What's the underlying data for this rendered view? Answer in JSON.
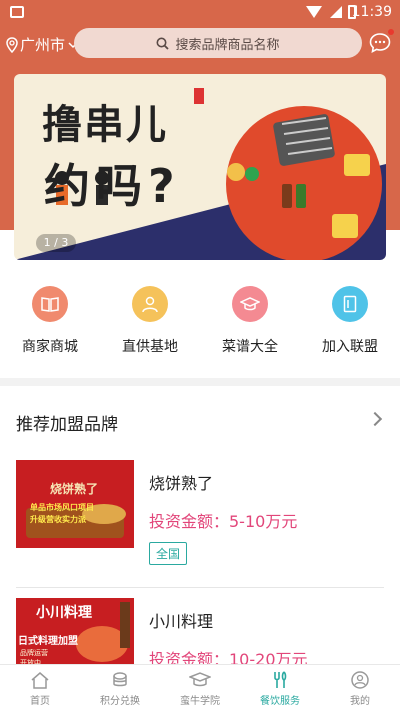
{
  "status": {
    "time": "11:39"
  },
  "header": {
    "city": "广州市",
    "search_placeholder": "搜索品牌商品名称"
  },
  "banner": {
    "title": "撸串儿",
    "subtitle": "约吗?",
    "pager": "1 / 3"
  },
  "grid": [
    {
      "label": "商家商城",
      "icon": "shop-book-icon",
      "color": "#f08a6e"
    },
    {
      "label": "直供基地",
      "icon": "person-icon",
      "color": "#f5c25a"
    },
    {
      "label": "菜谱大全",
      "icon": "graduation-cap-icon",
      "color": "#f48a92"
    },
    {
      "label": "加入联盟",
      "icon": "document-icon",
      "color": "#4fc3e8"
    }
  ],
  "section": {
    "title": "推荐加盟品牌"
  },
  "brands": [
    {
      "name": "烧饼熟了",
      "invest": "投资金额：5-10万元",
      "tag": "全国",
      "thumb_text": "烧饼熟了",
      "thumb_sub": "单品市场风口项目",
      "thumb_sub2": "升级营收实力派"
    },
    {
      "name": "小川料理",
      "invest": "投资金额：10-20万元",
      "thumb_text": "小川料理",
      "thumb_sub": "日式料理加盟",
      "thumb_sub2": "品牌运营",
      "thumb_sub3": "开放中"
    }
  ],
  "tabs": [
    {
      "label": "首页",
      "icon": "home-icon",
      "active": false
    },
    {
      "label": "积分兑换",
      "icon": "coins-icon",
      "active": false
    },
    {
      "label": "蛮牛学院",
      "icon": "academy-icon",
      "active": false
    },
    {
      "label": "餐饮服务",
      "icon": "fork-knife-icon",
      "active": true
    },
    {
      "label": "我的",
      "icon": "profile-icon",
      "active": false
    }
  ]
}
